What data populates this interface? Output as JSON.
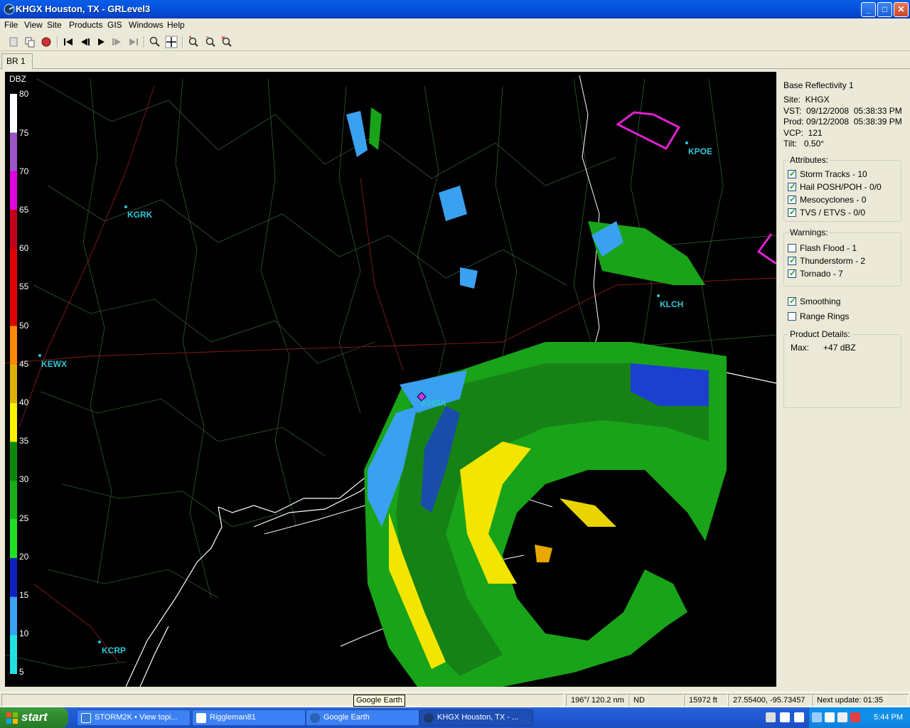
{
  "window": {
    "title": "KHGX Houston, TX - GRLevel3",
    "min": "_",
    "max": "□",
    "close": "✕"
  },
  "menu": [
    "File",
    "View",
    "Site",
    "Products",
    "GIS",
    "Windows",
    "Help"
  ],
  "tabs": [
    "BR 1"
  ],
  "legend": {
    "title": "DBZ",
    "ticks": [
      "80",
      "75",
      "70",
      "65",
      "60",
      "55",
      "50",
      "45",
      "40",
      "35",
      "30",
      "25",
      "20",
      "15",
      "10",
      "5"
    ]
  },
  "sites": {
    "kgrk": "KGRK",
    "kewx": "KEWX",
    "khgx": "KHGX",
    "kpoe": "KPOE",
    "klch": "KLCH",
    "kcrp": "KCRP"
  },
  "panel": {
    "product": "Base Reflectivity 1",
    "site": "Site:  KHGX",
    "vst": "VST:  09/12/2008  05:38:33 PM",
    "prod": "Prod: 09/12/2008  05:38:39 PM",
    "vcp": "VCP:  121",
    "tilt": "Tilt:   0.50°",
    "attributes_label": "Attributes:",
    "attributes": [
      "Storm Tracks - 10",
      "Hail POSH/POH - 0/0",
      "Mesocyclones - 0",
      "TVS / ETVS - 0/0"
    ],
    "warnings_label": "Warnings:",
    "warnings": [
      "Flash Flood - 1",
      "Thunderstorm - 2",
      "Tornado - 7"
    ],
    "smoothing": "Smoothing",
    "range_rings": "Range Rings",
    "details_label": "Product Details:",
    "max": "Max:      +47 dBZ"
  },
  "checks": {
    "storm_tracks": true,
    "hail": true,
    "meso": true,
    "tvs": true,
    "flash_flood": false,
    "thunderstorm": true,
    "tornado": true,
    "smoothing": true,
    "range_rings": false
  },
  "status": {
    "tooltip": "Google Earth",
    "azimuth": "196°/ 120.2 nm",
    "nd": "ND",
    "height": "15972 ft",
    "coords": "27.55400, -95.73457",
    "next_update": "Next update: 01:35"
  },
  "taskbar": {
    "start": "start",
    "tasks": [
      "STORM2K • View topi...",
      "Riggleman81",
      "Google Earth",
      "KHGX Houston, TX - ..."
    ],
    "clock": "5:44 PM"
  },
  "colors": {
    "site_label": "#2fc7d6",
    "warning_polygon": "#e020d0",
    "titlebar": "#0554e0"
  }
}
